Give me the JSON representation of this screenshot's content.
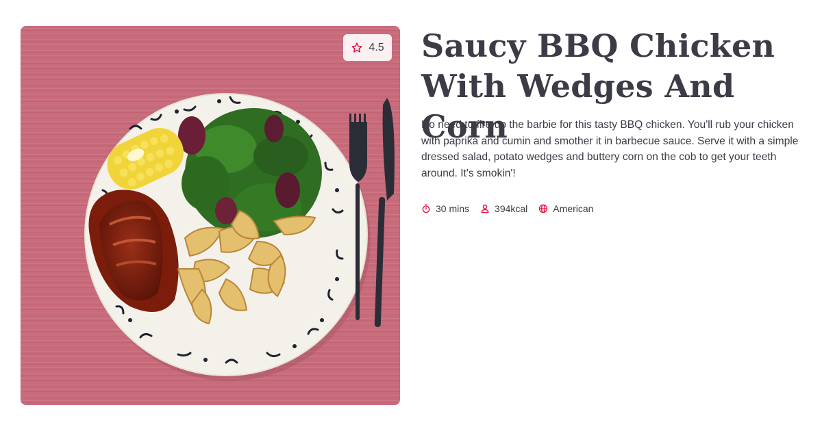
{
  "recipe": {
    "image_alt": "BBQ chicken with potato wedges, corn and salad on a plate",
    "rating": "4.5",
    "title": "Saucy BBQ Chicken With Wedges And Corn",
    "description": "No need to fire up the barbie for this tasty BBQ chicken. You'll rub your chicken with paprika and cumin and smother it in barbecue sauce. Serve it with a simple dressed salad, potato wedges and buttery corn on the cob to get your teeth around. It's smokin'!",
    "meta": {
      "time": "30 mins",
      "calories": "394kcal",
      "cuisine": "American"
    }
  },
  "icons": {
    "rating": "star-icon",
    "time": "timer-icon",
    "calories": "person-icon",
    "cuisine": "globe-icon"
  },
  "colors": {
    "accent": "#e4113f",
    "text": "#3b3c46",
    "background_wood": "#c76a7a"
  }
}
